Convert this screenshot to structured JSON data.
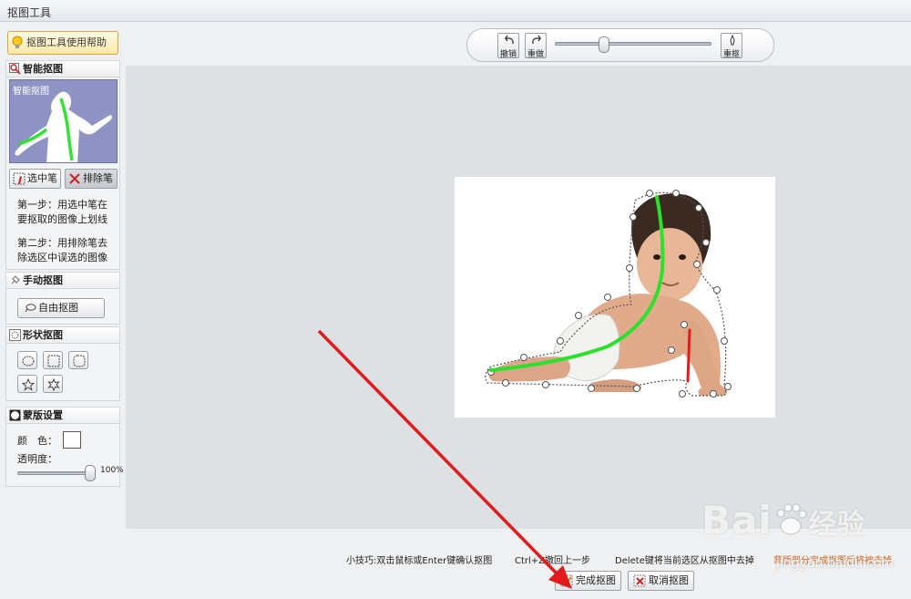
{
  "window": {
    "title": "抠图工具"
  },
  "sidebar": {
    "help_button": "抠图工具使用帮助",
    "smart": {
      "title": "智能抠图",
      "preview_label": "智能抠图",
      "select_pen": "选中笔",
      "erase_pen": "排除笔",
      "step1": "第一步：用选中笔在要抠取的图像上划线",
      "step2": "第二步：用排除笔去除选区中误选的图像"
    },
    "manual": {
      "title": "手动抠图",
      "free_button": "自由抠图"
    },
    "shape": {
      "title": "形状抠图",
      "buttons": [
        "ellipse-icon",
        "rect-icon",
        "rounded-rect-icon",
        "star-icon",
        "star6-icon"
      ]
    },
    "mask": {
      "title": "蒙版设置",
      "color_label": "颜　色：",
      "color_value": "#ffffff",
      "opacity_label": "透明度：",
      "opacity_value": "100%",
      "opacity_level": 1.0
    }
  },
  "toolbar": {
    "undo": "撤销",
    "redo": "重做",
    "reset": "重抠",
    "zoom_level": 0.3
  },
  "tips": {
    "tip1": "小技巧:双击鼠标或Enter键确认抠图",
    "tip2": "Ctrl+Z撤回上一步",
    "tip3": "Delete键将当前选区从抠图中去掉",
    "tip4": "蒙版部分完成抠图后将被去掉"
  },
  "actions": {
    "finish": "完成抠图",
    "cancel": "取消抠图"
  },
  "watermark": {
    "brand": "Bai",
    "brand_cn": "经验",
    "site": "jingyan.baidu.com"
  },
  "colors": {
    "accent": "#e0a23a",
    "green_stroke": "#2ee02e",
    "red_arrow": "#e11b1b",
    "canvas": "#dde1e3"
  }
}
